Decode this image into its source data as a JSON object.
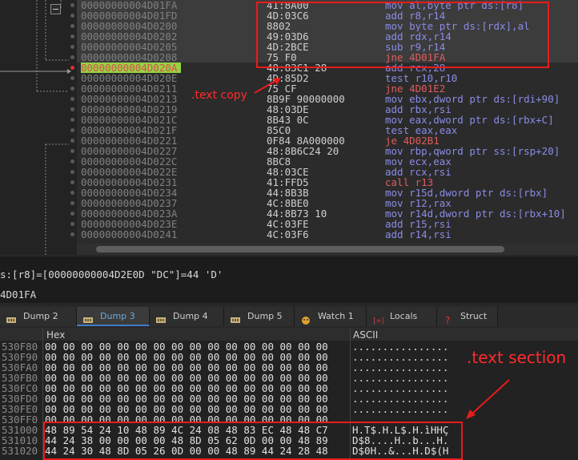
{
  "disasm": {
    "rows": [
      {
        "addr": "00000000004D01FA",
        "bytes": "41:8A00",
        "ins": "mov al,byte ptr ds:[r8]",
        "jump": false,
        "hl": true,
        "rip": false
      },
      {
        "addr": "00000000004D01FD",
        "bytes": "4D:03C6",
        "ins": "add r8,r14",
        "jump": false,
        "hl": true,
        "rip": false
      },
      {
        "addr": "00000000004D0200",
        "bytes": "8802",
        "ins": "mov byte ptr ds:[rdx],al",
        "jump": false,
        "hl": true,
        "rip": false
      },
      {
        "addr": "00000000004D0202",
        "bytes": "49:03D6",
        "ins": "add rdx,r14",
        "jump": false,
        "hl": true,
        "rip": false
      },
      {
        "addr": "00000000004D0205",
        "bytes": "4D:2BCE",
        "ins": "sub r9,r14",
        "jump": false,
        "hl": true,
        "rip": false
      },
      {
        "addr": "00000000004D0208",
        "bytes": "75 F0",
        "ins": "jne 4D01FA",
        "jump": true,
        "hl": true,
        "rip": false
      },
      {
        "addr": "00000000004D020A",
        "bytes": "48:83C1 28",
        "ins": "add rcx,28",
        "jump": false,
        "hl": false,
        "rip": true
      },
      {
        "addr": "00000000004D020E",
        "bytes": "4D:85D2",
        "ins": "test r10,r10",
        "jump": false,
        "hl": false,
        "rip": false
      },
      {
        "addr": "00000000004D0211",
        "bytes": "75 CF",
        "ins": "jne 4D01E2",
        "jump": true,
        "hl": false,
        "rip": false
      },
      {
        "addr": "00000000004D0213",
        "bytes": "8B9F 90000000",
        "ins": "mov ebx,dword ptr ds:[rdi+90]",
        "jump": false,
        "hl": false,
        "rip": false
      },
      {
        "addr": "00000000004D0219",
        "bytes": "48:03DE",
        "ins": "add rbx,rsi",
        "jump": false,
        "hl": false,
        "rip": false
      },
      {
        "addr": "00000000004D021C",
        "bytes": "8B43 0C",
        "ins": "mov eax,dword ptr ds:[rbx+C]",
        "jump": false,
        "hl": false,
        "rip": false
      },
      {
        "addr": "00000000004D021F",
        "bytes": "85C0",
        "ins": "test eax,eax",
        "jump": false,
        "hl": false,
        "rip": false
      },
      {
        "addr": "00000000004D0221",
        "bytes": "0F84 8A000000",
        "ins": "je 4D02B1",
        "jump": true,
        "hl": false,
        "rip": false
      },
      {
        "addr": "00000000004D0227",
        "bytes": "48:8B6C24 20",
        "ins": "mov rbp,qword ptr ss:[rsp+20]",
        "jump": false,
        "hl": false,
        "rip": false
      },
      {
        "addr": "00000000004D022C",
        "bytes": "8BC8",
        "ins": "mov ecx,eax",
        "jump": false,
        "hl": false,
        "rip": false
      },
      {
        "addr": "00000000004D022E",
        "bytes": "48:03CE",
        "ins": "add rcx,rsi",
        "jump": false,
        "hl": false,
        "rip": false
      },
      {
        "addr": "00000000004D0231",
        "bytes": "41:FFD5",
        "ins": "call r13",
        "jump": true,
        "hl": false,
        "rip": false
      },
      {
        "addr": "00000000004D0234",
        "bytes": "44:8B3B",
        "ins": "mov r15d,dword ptr ds:[rbx]",
        "jump": false,
        "hl": false,
        "rip": false
      },
      {
        "addr": "00000000004D0237",
        "bytes": "4C:8BE0",
        "ins": "mov r12,rax",
        "jump": false,
        "hl": false,
        "rip": false
      },
      {
        "addr": "00000000004D023A",
        "bytes": "44:8B73 10",
        "ins": "mov r14d,dword ptr ds:[rbx+10]",
        "jump": false,
        "hl": false,
        "rip": false
      },
      {
        "addr": "00000000004D023E",
        "bytes": "4C:03FE",
        "ins": "add r15,rsi",
        "jump": false,
        "hl": false,
        "rip": false
      },
      {
        "addr": "00000000004D0241",
        "bytes": "4C:03F6",
        "ins": "add r14,rsi",
        "jump": false,
        "hl": false,
        "rip": false
      }
    ]
  },
  "info": {
    "line1": "s:[r8]=[00000000004D2E0D \"DC\"]=44 'D'",
    "line2": "4D01FA"
  },
  "tabs": [
    {
      "label": "Dump 2",
      "icon": "memory-dump-icon",
      "active": false
    },
    {
      "label": "Dump 3",
      "icon": "memory-dump-icon",
      "active": true
    },
    {
      "label": "Dump 4",
      "icon": "memory-dump-icon",
      "active": false
    },
    {
      "label": "Dump 5",
      "icon": "memory-dump-icon",
      "active": false
    },
    {
      "label": "Watch 1",
      "icon": "watch-icon",
      "active": false
    },
    {
      "label": "Locals",
      "icon": "locals-icon",
      "active": false
    },
    {
      "label": "Struct",
      "icon": "struct-icon",
      "active": false
    }
  ],
  "hexdump": {
    "header_hex": "Hex",
    "header_ascii": "ASCII",
    "rows": [
      {
        "addr": "530F80",
        "bytes": "00 00 00 00 00 00 00 00 00 00 00 00 00 00 00 00",
        "ascii": "................"
      },
      {
        "addr": "530F90",
        "bytes": "00 00 00 00 00 00 00 00 00 00 00 00 00 00 00 00",
        "ascii": "................"
      },
      {
        "addr": "530FA0",
        "bytes": "00 00 00 00 00 00 00 00 00 00 00 00 00 00 00 00",
        "ascii": "................"
      },
      {
        "addr": "530FB0",
        "bytes": "00 00 00 00 00 00 00 00 00 00 00 00 00 00 00 00",
        "ascii": "................"
      },
      {
        "addr": "530FC0",
        "bytes": "00 00 00 00 00 00 00 00 00 00 00 00 00 00 00 00",
        "ascii": "................"
      },
      {
        "addr": "530FD0",
        "bytes": "00 00 00 00 00 00 00 00 00 00 00 00 00 00 00 00",
        "ascii": "................"
      },
      {
        "addr": "530FE0",
        "bytes": "00 00 00 00 00 00 00 00 00 00 00 00 00 00 00 00",
        "ascii": "................"
      },
      {
        "addr": "530FF0",
        "bytes": "00 00 00 00 00 00 00 00 00 00 00 00 00 00 00 00",
        "ascii": "................"
      },
      {
        "addr": "531000",
        "bytes": "48 89 54 24 10 48 89 4C 24 08 48 83 EC 48 48 C7",
        "ascii": "H.T$.H.L$.H.ìHHÇ"
      },
      {
        "addr": "531010",
        "bytes": "44 24 38 00 00 00 00 48 8D 05 62 0D 00 00 48 89",
        "ascii": "D$8....H..b...H."
      },
      {
        "addr": "531020",
        "bytes": "44 24 30 48 8D 05 26 0D 00 00 48 89 44 24 28 48",
        "ascii": "D$0H..&...H.D$(H"
      }
    ]
  },
  "annotations": {
    "text_copy": ".text copy",
    "text_section": ".text section",
    "color": "#ff2b2b"
  }
}
